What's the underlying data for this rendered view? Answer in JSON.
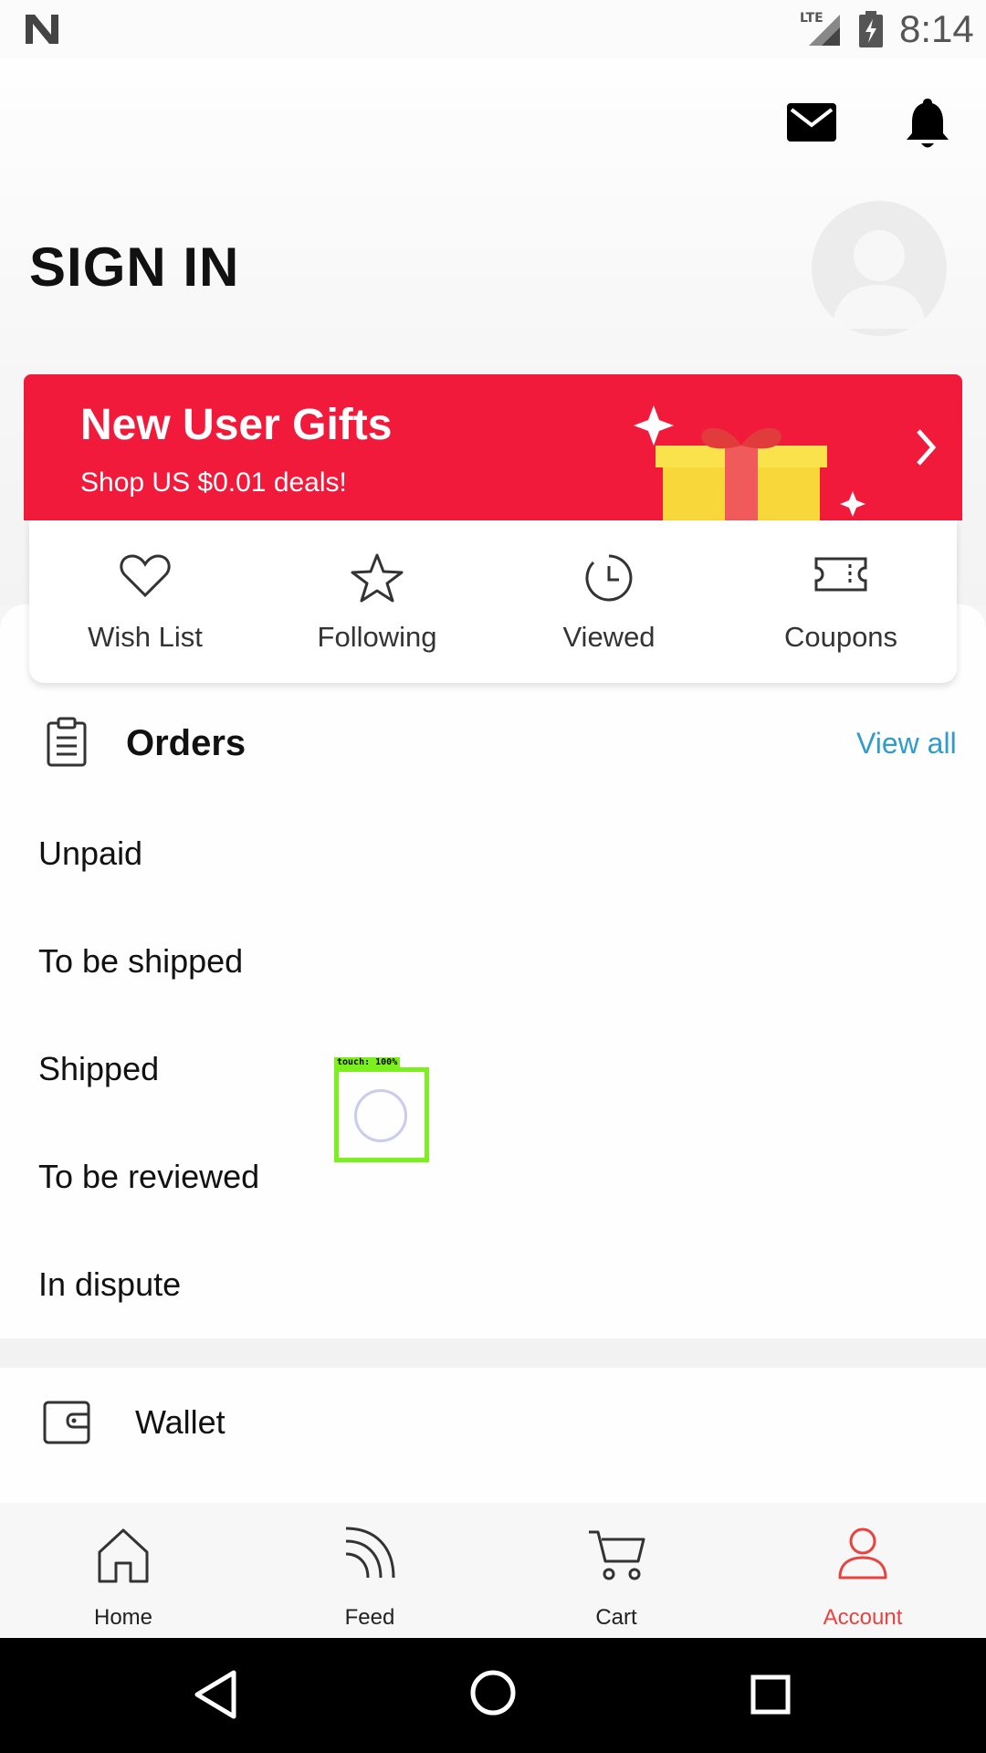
{
  "status_bar": {
    "network": "LTE",
    "time": "8:14"
  },
  "header": {
    "title": "SIGN IN",
    "icons": [
      "mail-icon",
      "bell-icon",
      "avatar"
    ]
  },
  "banner": {
    "title": "New User Gifts",
    "subtitle": "Shop US $0.01 deals!",
    "accent_color": "#f21a3b"
  },
  "quick_links": [
    {
      "label": "Wish List",
      "icon": "heart-icon"
    },
    {
      "label": "Following",
      "icon": "star-icon"
    },
    {
      "label": "Viewed",
      "icon": "clock-icon"
    },
    {
      "label": "Coupons",
      "icon": "coupon-icon"
    }
  ],
  "orders": {
    "title": "Orders",
    "view_all": "View all",
    "link_color": "#2f9ccd",
    "items": [
      "Unpaid",
      "To be shipped",
      "Shipped",
      "To be reviewed",
      "In dispute"
    ]
  },
  "wallet": {
    "label": "Wallet"
  },
  "touch_overlay": {
    "label": "touch: 100%"
  },
  "bottom_nav": {
    "active_color": "#e8443f",
    "items": [
      {
        "label": "Home",
        "icon": "home-icon"
      },
      {
        "label": "Feed",
        "icon": "feed-icon"
      },
      {
        "label": "Cart",
        "icon": "cart-icon"
      },
      {
        "label": "Account",
        "icon": "account-icon",
        "active": true
      }
    ]
  }
}
